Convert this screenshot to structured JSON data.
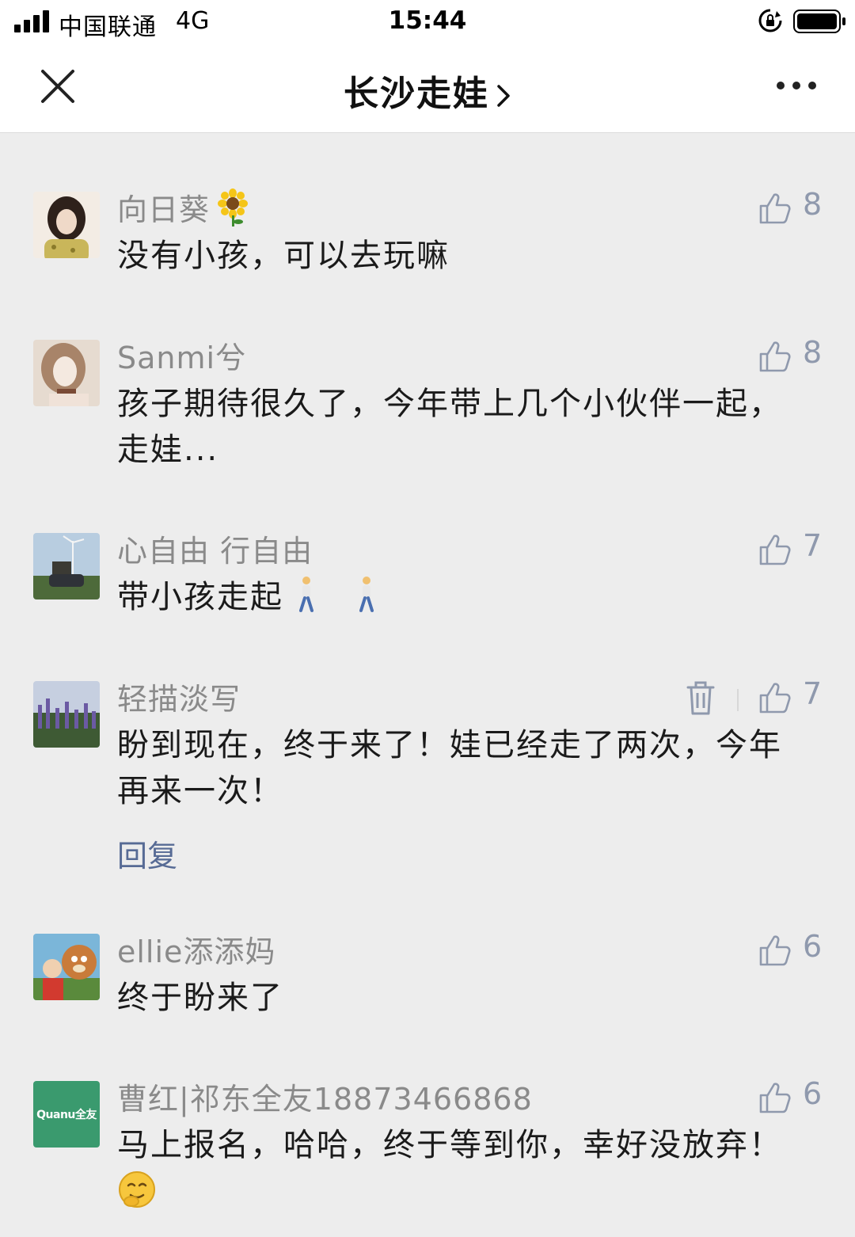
{
  "status_bar": {
    "carrier": "中国联通",
    "network": "4G",
    "time": "15:44"
  },
  "nav": {
    "title": "长沙走娃"
  },
  "comments": [
    {
      "author": "向日葵",
      "text": "没有小孩，可以去玩嘛",
      "likes": "8",
      "avatar_colors": [
        "#3a2a22",
        "#e9d6c8",
        "#c9b65a"
      ]
    },
    {
      "author": "Sanmi兮",
      "text": "孩子期待很久了，今年带上几个小伙伴一起，走娃...",
      "likes": "8",
      "avatar_colors": [
        "#b59a83",
        "#f1e6dc",
        "#7a4a35"
      ]
    },
    {
      "author": "心自由 行自由",
      "text": "带小孩走起",
      "likes": "7",
      "avatar_colors": [
        "#b8cde0",
        "#4d6a3a",
        "#2f3238"
      ]
    },
    {
      "author": "轻描淡写",
      "text": "盼到现在，终于来了！娃已经走了两次，今年再来一次！",
      "likes": "7",
      "reply_label": "回复",
      "avatar_colors": [
        "#b7c3d8",
        "#5d4d86",
        "#3e5a34"
      ]
    },
    {
      "author": "ellie添添妈",
      "text": "终于盼来了",
      "likes": "6",
      "avatar_colors": [
        "#7bb6d9",
        "#c97b3a",
        "#d23a2f"
      ]
    },
    {
      "author": "曹红|祁东全友18873466868",
      "text": "马上报名，哈哈，终于等到你，幸好没放弃！",
      "likes": "6",
      "avatar_logo_text": "Quanu全友",
      "avatar_colors": [
        "#3a9a6e"
      ]
    }
  ],
  "colors": {
    "background": "#ededed",
    "author": "#8a8a8a",
    "link": "#576b95",
    "like_icon": "#8f99ad"
  }
}
